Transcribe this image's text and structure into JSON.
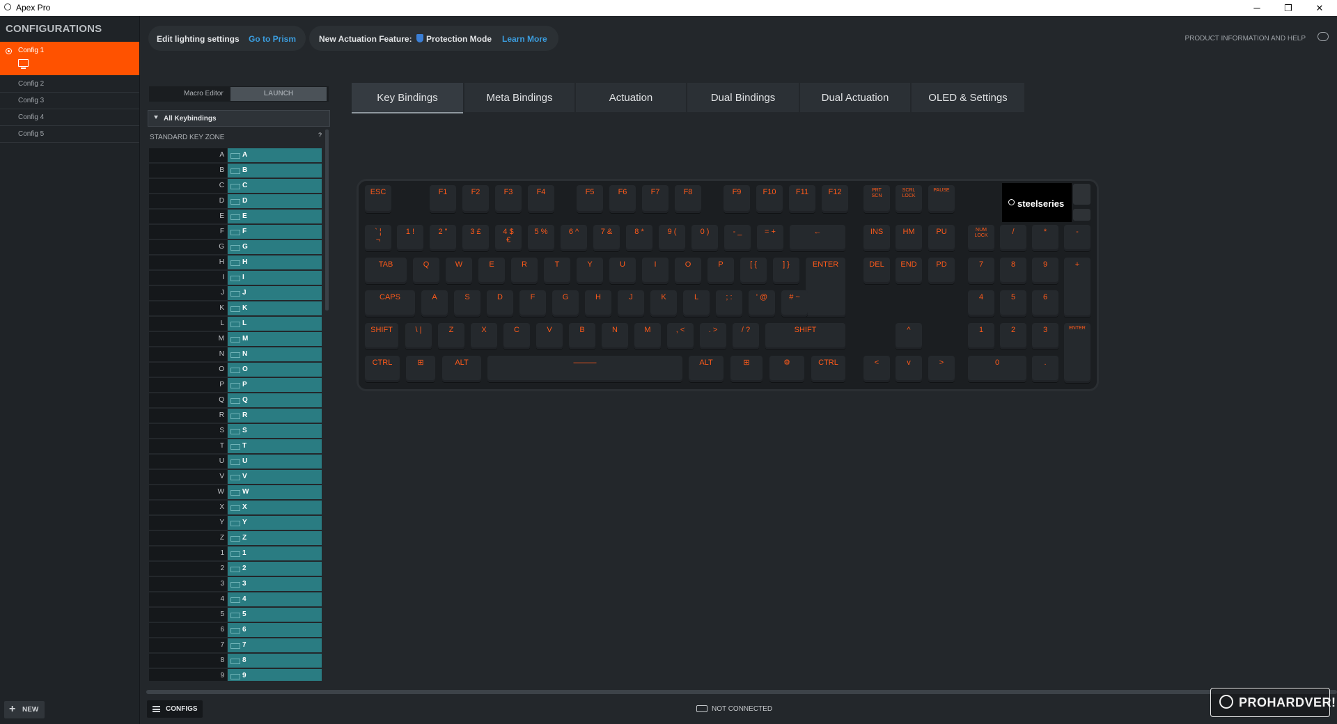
{
  "window": {
    "title": "Apex Pro",
    "minimize": "─",
    "restore": "❐",
    "close": "✕"
  },
  "sidebar": {
    "heading": "CONFIGURATIONS",
    "active_config": "Config 1",
    "configs": [
      "Config 2",
      "Config 3",
      "Config 4",
      "Config 5"
    ],
    "new_button": "NEW"
  },
  "topbar": {
    "lighting_label": "Edit lighting settings",
    "lighting_link": "Go to Prism",
    "feature_label": "New Actuation Feature:",
    "feature_name": "Protection Mode",
    "feature_link": "Learn More",
    "help": "PRODUCT INFORMATION AND HELP"
  },
  "left_panel": {
    "macro_editor": "Macro Editor",
    "launch": "LAUNCH",
    "dropdown": "All Keybindings",
    "zone": "STANDARD KEY ZONE",
    "zone_help": "?",
    "rows": [
      [
        "A",
        "A"
      ],
      [
        "B",
        "B"
      ],
      [
        "C",
        "C"
      ],
      [
        "D",
        "D"
      ],
      [
        "E",
        "E"
      ],
      [
        "F",
        "F"
      ],
      [
        "G",
        "G"
      ],
      [
        "H",
        "H"
      ],
      [
        "I",
        "I"
      ],
      [
        "J",
        "J"
      ],
      [
        "K",
        "K"
      ],
      [
        "L",
        "L"
      ],
      [
        "M",
        "M"
      ],
      [
        "N",
        "N"
      ],
      [
        "O",
        "O"
      ],
      [
        "P",
        "P"
      ],
      [
        "Q",
        "Q"
      ],
      [
        "R",
        "R"
      ],
      [
        "S",
        "S"
      ],
      [
        "T",
        "T"
      ],
      [
        "U",
        "U"
      ],
      [
        "V",
        "V"
      ],
      [
        "W",
        "W"
      ],
      [
        "X",
        "X"
      ],
      [
        "Y",
        "Y"
      ],
      [
        "Z",
        "Z"
      ],
      [
        "1",
        "1"
      ],
      [
        "2",
        "2"
      ],
      [
        "3",
        "3"
      ],
      [
        "4",
        "4"
      ],
      [
        "5",
        "5"
      ],
      [
        "6",
        "6"
      ],
      [
        "7",
        "7"
      ],
      [
        "8",
        "8"
      ],
      [
        "9",
        "9"
      ]
    ]
  },
  "tabs": [
    "Key Bindings",
    "Meta Bindings",
    "Actuation",
    "Dual Bindings",
    "Dual Actuation",
    "OLED & Settings"
  ],
  "active_tab": "Key Bindings",
  "keyboard": {
    "brand": "steelseries",
    "accent_color": "#ff5a1a",
    "rows": {
      "fn": [
        "ESC",
        "F1",
        "F2",
        "F3",
        "F4",
        "F5",
        "F6",
        "F7",
        "F8",
        "F9",
        "F10",
        "F11",
        "F12",
        "PRT\nSCN",
        "SCRL\nLOCK",
        "PAUSE"
      ],
      "num": [
        "` ¦\n¬",
        "1 !",
        "2 \"",
        "3 £",
        "4 $\n€",
        "5 %",
        "6 ^",
        "7 &",
        "8 *",
        "9 (",
        "0 )",
        "- _",
        "= +",
        "←",
        "INS",
        "HM",
        "PU",
        "NUM\nLOCK",
        "/",
        "*",
        "-"
      ],
      "qwerty": [
        "TAB",
        "Q",
        "W",
        "E",
        "R",
        "T",
        "Y",
        "U",
        "I",
        "O",
        "P",
        "[ {",
        "] }",
        "ENTER",
        "DEL",
        "END",
        "PD",
        "7",
        "8",
        "9",
        "+"
      ],
      "home": [
        "CAPS",
        "A",
        "S",
        "D",
        "F",
        "G",
        "H",
        "J",
        "K",
        "L",
        "; :",
        "' @",
        "# ~",
        "4",
        "5",
        "6"
      ],
      "shift": [
        "SHIFT",
        "\\ |",
        "Z",
        "X",
        "C",
        "V",
        "B",
        "N",
        "M",
        ", <",
        ". >",
        "/ ?",
        "SHIFT",
        "^",
        "1",
        "2",
        "3",
        "ENTER"
      ],
      "bottom": [
        "CTRL",
        "⊞",
        "ALT",
        "———",
        "ALT",
        "⊞",
        "⚙",
        "CTRL",
        "<",
        "v",
        ">",
        "0",
        "."
      ]
    }
  },
  "bottom": {
    "configs_button": "CONFIGS",
    "status": "NOT CONNECTED",
    "watermark": "PROHARDVER!"
  }
}
